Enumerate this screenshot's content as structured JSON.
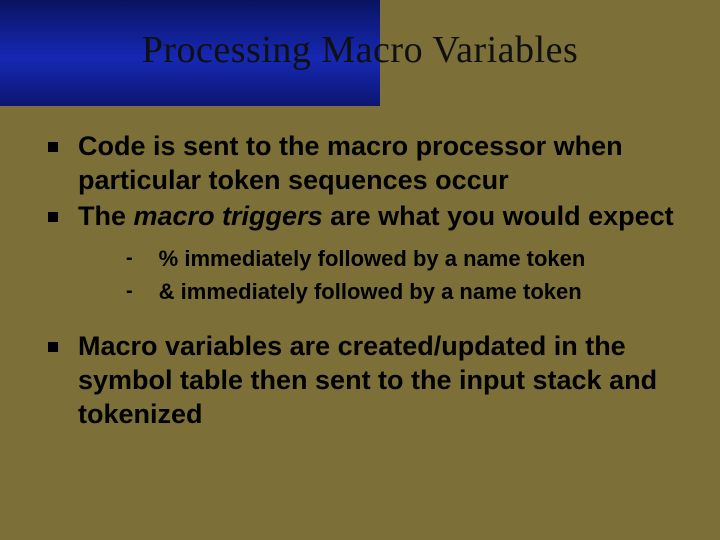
{
  "title": "Processing Macro Variables",
  "bullets": {
    "b1": "Code is sent to the macro processor when particular token sequences occur",
    "b2_pre": "The ",
    "b2_em": "macro triggers",
    "b2_post": " are what you would expect",
    "sub1": "% immediately followed by a name token",
    "sub2": "& immediately followed by a name token",
    "b3": "Macro variables are created/updated in the symbol table then sent to the input stack and tokenized"
  },
  "markers": {
    "dash": "-"
  }
}
